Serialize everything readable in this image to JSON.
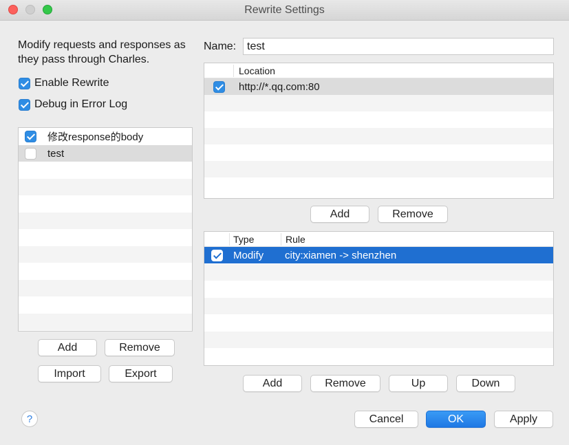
{
  "window": {
    "title": "Rewrite Settings"
  },
  "left": {
    "description": "Modify requests and responses as they pass through Charles.",
    "enable_rewrite": "Enable Rewrite",
    "debug_error_log": "Debug in Error Log",
    "sets": [
      {
        "name": "修改response的body",
        "checked": true
      },
      {
        "name": "test",
        "checked": false
      }
    ],
    "buttons": {
      "add": "Add",
      "remove": "Remove",
      "import": "Import",
      "export": "Export"
    }
  },
  "name_label": "Name:",
  "name_value": "test",
  "locations": {
    "header": "Location",
    "rows": [
      {
        "location": "http://*.qq.com:80",
        "checked": true
      }
    ],
    "buttons": {
      "add": "Add",
      "remove": "Remove"
    }
  },
  "rules": {
    "headers": {
      "type": "Type",
      "rule": "Rule"
    },
    "rows": [
      {
        "type": "Modify",
        "rule": "city:xiamen -> shenzhen",
        "checked": true
      }
    ],
    "buttons": {
      "add": "Add",
      "remove": "Remove",
      "up": "Up",
      "down": "Down"
    }
  },
  "footer": {
    "help": "?",
    "cancel": "Cancel",
    "ok": "OK",
    "apply": "Apply"
  },
  "colors": {
    "accent": "#1f78e4",
    "selected_row": "#1f6fd1",
    "gray_selected": "#dcdcdc"
  }
}
